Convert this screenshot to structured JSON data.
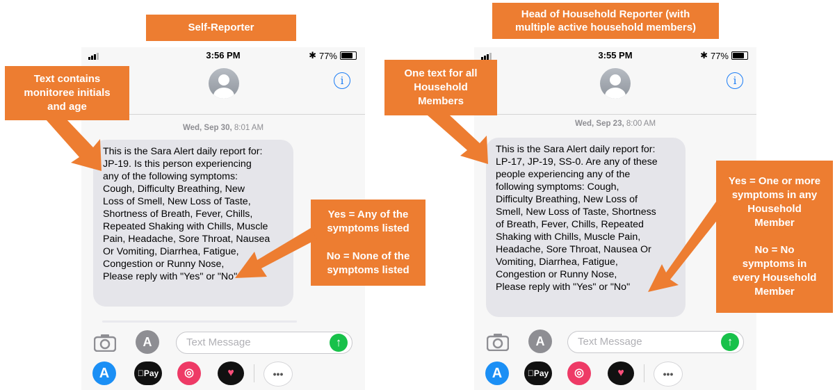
{
  "left": {
    "title": "Self-Reporter",
    "status": {
      "time": "3:56 PM",
      "battery": "77%",
      "battery_level": 0.77
    },
    "date_prefix": "Wed, Sep 30,",
    "date_time": " 8:01 AM",
    "message": "This is the Sara Alert daily report for:\nJP-19. Is this person experiencing\nany of the following symptoms:\nCough, Difficulty Breathing, New\nLoss of Smell, New Loss of Taste,\nShortness of Breath, Fever, Chills,\nRepeated Shaking with Chills, Muscle\nPain, Headache, Sore Throat, Nausea\nOr Vomiting, Diarrhea, Fatigue,\nCongestion or Runny Nose,\nPlease reply with \"Yes\" or \"No\"",
    "input_placeholder": "Text Message",
    "callout_top": "Text contains\nmonitoree initials\nand age",
    "callout_right": "Yes = Any of the\nsymptoms listed\n\nNo = None of the\nsymptoms listed"
  },
  "right": {
    "title": "Head of Household Reporter (with\nmultiple active household  members)",
    "status": {
      "time": "3:55 PM",
      "battery": "77%",
      "battery_level": 0.77
    },
    "date_prefix": "Wed, Sep 23,",
    "date_time": " 8:00 AM",
    "message": "This is the Sara Alert daily report for:\nLP-17, JP-19, SS-0. Are any of these\npeople experiencing any of the\nfollowing symptoms: Cough,\nDifficulty Breathing, New Loss of\nSmell, New Loss of Taste, Shortness\nof Breath, Fever, Chills, Repeated\nShaking with Chills, Muscle Pain,\nHeadache, Sore Throat, Nausea Or\nVomiting, Diarrhea, Fatigue,\nCongestion or Runny Nose,\nPlease reply with \"Yes\" or \"No\"",
    "input_placeholder": "Text Message",
    "callout_top": "One text for all\nHousehold\nMembers",
    "callout_right": "Yes = One or more\nsymptoms in any\nHousehold\nMember\n\nNo = No\nsymptoms in\nevery Household\nMember"
  },
  "tray": {
    "pay_label": "Pay",
    "more_label": "•••"
  },
  "colors": {
    "callout": "#ED7D31",
    "bubble": "#e5e5ea",
    "send": "#18c14a",
    "link": "#1a7cf5"
  },
  "icons": [
    "signal-icon",
    "bluetooth-icon",
    "battery-icon",
    "contact-avatar-icon",
    "info-icon",
    "camera-icon",
    "app-store-icon",
    "apple-pay-icon",
    "search-globe-icon",
    "heart-sticker-icon",
    "more-icon",
    "send-arrow-icon"
  ]
}
